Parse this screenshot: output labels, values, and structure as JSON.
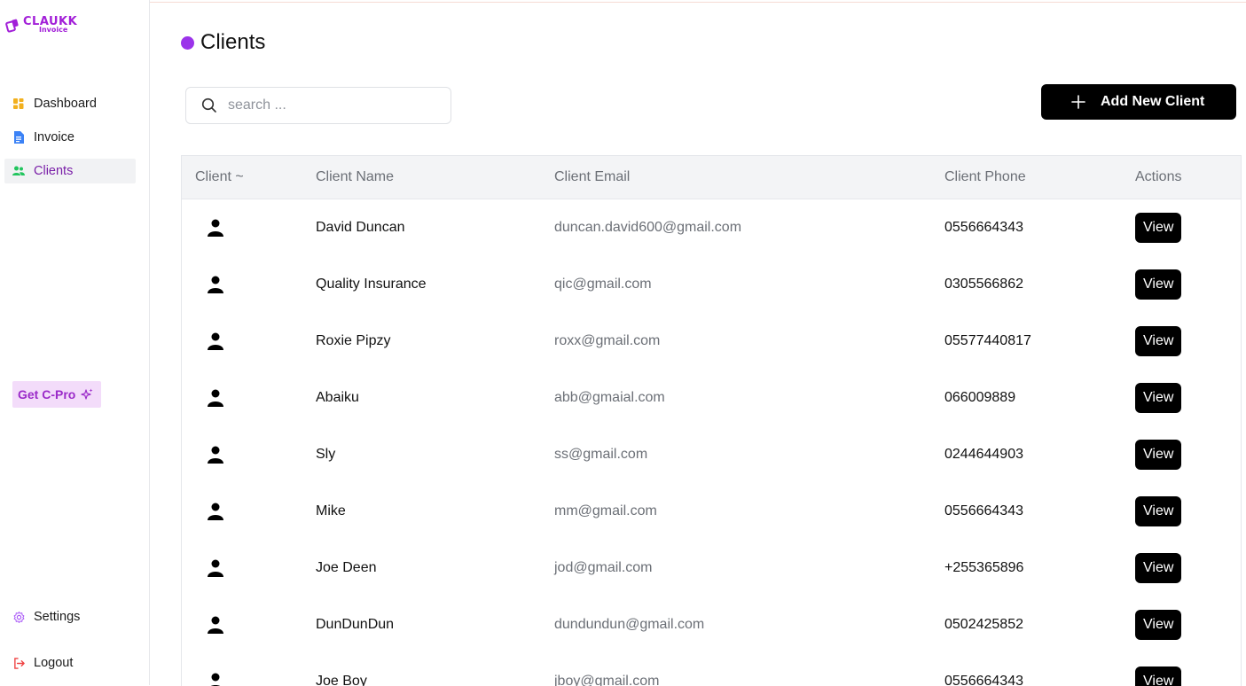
{
  "app": {
    "logo_main": "CLAUKK",
    "logo_sub": "Invoice",
    "brand_color": "#a21fd8"
  },
  "sidebar": {
    "items": [
      {
        "label": "Dashboard",
        "icon": "dashboard-grid-icon",
        "active": false
      },
      {
        "label": "Invoice",
        "icon": "document-icon",
        "active": false
      },
      {
        "label": "Clients",
        "icon": "users-icon",
        "active": true
      }
    ],
    "pro_label": "Get C-Pro",
    "settings_label": "Settings",
    "logout_label": "Logout"
  },
  "page": {
    "title": "Clients",
    "search_placeholder": "search ...",
    "add_button_label": "Add New Client"
  },
  "table": {
    "headers": [
      "Client ~",
      "Client Name",
      "Client Email",
      "Client Phone",
      "Actions"
    ],
    "rows": [
      {
        "name": "David Duncan",
        "email": "duncan.david600@gmail.com",
        "phone": "0556664343",
        "action": "View"
      },
      {
        "name": "Quality Insurance",
        "email": "qic@gmail.com",
        "phone": "0305566862",
        "action": "View"
      },
      {
        "name": "Roxie Pipzy",
        "email": "roxx@gmail.com",
        "phone": "05577440817",
        "action": "View"
      },
      {
        "name": "Abaiku",
        "email": "abb@gmaial.com",
        "phone": "066009889",
        "action": "View"
      },
      {
        "name": "Sly",
        "email": "ss@gmail.com",
        "phone": "0244644903",
        "action": "View"
      },
      {
        "name": "Mike",
        "email": "mm@gmail.com",
        "phone": "0556664343",
        "action": "View"
      },
      {
        "name": "Joe Deen",
        "email": "jod@gmail.com",
        "phone": "+255365896",
        "action": "View"
      },
      {
        "name": "DunDunDun",
        "email": "dundundun@gmail.com",
        "phone": "0502425852",
        "action": "View"
      },
      {
        "name": "Joe Boy",
        "email": "jboy@gmail.com",
        "phone": "0556664343",
        "action": "View"
      }
    ]
  }
}
